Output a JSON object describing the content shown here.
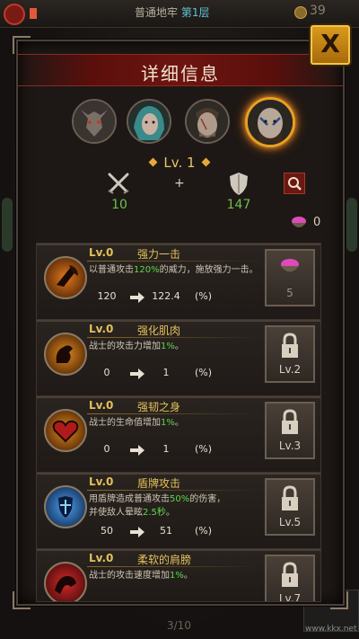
{
  "hud": {
    "floor_label": "普通地牢",
    "floor_level": "第1层",
    "gold": "39",
    "turn_counter": "3/10"
  },
  "dialog": {
    "title": "详细信息",
    "close_label": "X"
  },
  "heroes": [
    {
      "name": "goat-demon",
      "selected": false
    },
    {
      "name": "teal-haired-woman",
      "selected": false
    },
    {
      "name": "scarred-man",
      "selected": false
    },
    {
      "name": "tattooed-warrior",
      "selected": true
    }
  ],
  "level": "Lv. 1",
  "stats": {
    "attack": "10",
    "plus": "+",
    "defense": "147",
    "gems": "0"
  },
  "skills": [
    {
      "level": "Lv.0",
      "name": "强力一击",
      "desc_pre": "以普通攻击",
      "desc_hl": "120%",
      "desc_post": "的威力，施放强力一击。",
      "current": "120",
      "next": "122.4",
      "unit": "(%)",
      "slot": "5",
      "locked": false,
      "icon": "axe-strike-icon",
      "accent": "#e07a1a"
    },
    {
      "level": "Lv.0",
      "name": "强化肌肉",
      "desc_pre": "战士的攻击力增加",
      "desc_hl": "1%",
      "desc_post": "。",
      "current": "0",
      "next": "1",
      "unit": "(%)",
      "slot": "Lv.2",
      "locked": true,
      "icon": "muscle-icon",
      "accent": "#e08a1a"
    },
    {
      "level": "Lv.0",
      "name": "强韧之身",
      "desc_pre": "战士的生命值增加",
      "desc_hl": "1%",
      "desc_post": "。",
      "current": "0",
      "next": "1",
      "unit": "(%)",
      "slot": "Lv.3",
      "locked": true,
      "icon": "heart-icon",
      "accent": "#e08a1a"
    },
    {
      "level": "Lv.0",
      "name": "盾牌攻击",
      "desc_pre": "用盾牌造成普通攻击",
      "desc_hl": "50%",
      "desc_post": "的伤害，",
      "desc2_pre": "并使敌人晕眩",
      "desc2_hl": "2.5秒",
      "desc2_post": "。",
      "current": "50",
      "next": "51",
      "unit": "(%)",
      "slot": "Lv.5",
      "locked": true,
      "icon": "shield-bash-icon",
      "accent": "#3a8ae0"
    },
    {
      "level": "Lv.0",
      "name": "柔软的肩膀",
      "desc_pre": "战士的攻击速度增加",
      "desc_hl": "1%",
      "desc_post": "。",
      "current": "",
      "next": "",
      "unit": "",
      "slot": "Lv.7",
      "locked": true,
      "icon": "shoulder-icon",
      "accent": "#d02a2a"
    }
  ],
  "watermark": "www.kkx.net"
}
